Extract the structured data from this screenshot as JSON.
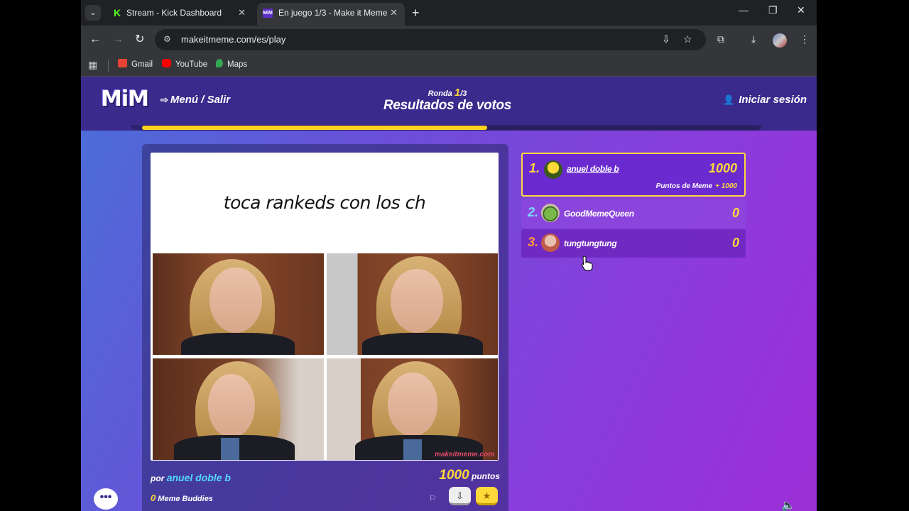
{
  "browser": {
    "tabs": [
      {
        "title": "Stream - Kick Dashboard",
        "favicon": "K",
        "active": false
      },
      {
        "title": "En juego 1/3 - Make it Meme",
        "favicon": "MiM",
        "active": true
      }
    ],
    "url": "makeitmeme.com/es/play",
    "bookmarks": [
      {
        "label": "Gmail",
        "color": "#ea4335"
      },
      {
        "label": "YouTube",
        "color": "#ff0000"
      },
      {
        "label": "Maps",
        "color": "#34a853"
      }
    ]
  },
  "header": {
    "logo": "MiM",
    "menu_label": "Menú / Salir",
    "round_label": "Ronda",
    "round_current": "1",
    "round_total": "/3",
    "title": "Resultados de votos",
    "login_label": "Iniciar sesión",
    "progress_fraction": 0.56
  },
  "meme": {
    "caption": "toca rankeds con los ch",
    "watermark": "makeitmeme.com",
    "by_label": "por",
    "author": "anuel doble b",
    "points_value": "1000",
    "points_label": "puntos",
    "buddies_value": "0",
    "buddies_label": "Meme Buddies"
  },
  "leaderboard": [
    {
      "rank": "1.",
      "name": "anuel doble b",
      "score": "1000",
      "sub_label": "Puntos de Meme",
      "sub_value": "+ 1000"
    },
    {
      "rank": "2.",
      "name": "GoodMemeQueen",
      "score": "0"
    },
    {
      "rank": "3.",
      "name": "tungtungtung",
      "score": "0"
    }
  ],
  "colors": {
    "accent_yellow": "#ffd83a",
    "author_cyan": "#53d8ff",
    "header_bg": "#3a2a8c"
  },
  "icons": [
    "menu-exit-icon",
    "user-icon",
    "flag-icon",
    "chat-icon",
    "sound-icon"
  ]
}
